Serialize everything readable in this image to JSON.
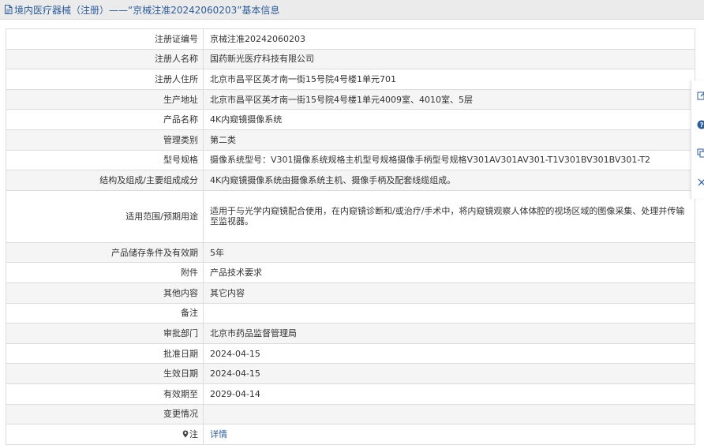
{
  "header": {
    "title": "境内医疗器械（注册）——“京械注准20242060203”基本信息"
  },
  "rows": [
    {
      "label": "注册证编号",
      "value": "京械注准20242060203"
    },
    {
      "label": "注册人名称",
      "value": "国药新光医疗科技有限公司"
    },
    {
      "label": "注册人住所",
      "value": "北京市昌平区英才南一街15号院4号楼1单元701"
    },
    {
      "label": "生产地址",
      "value": "北京市昌平区英才南一街15号院4号楼1单元4009室、4010室、5层"
    },
    {
      "label": "产品名称",
      "value": "4K内窥镜摄像系统"
    },
    {
      "label": "管理类别",
      "value": "第二类"
    },
    {
      "label": "型号规格",
      "value": "摄像系统型号：V301摄像系统规格主机型号规格摄像手柄型号规格V301AV301AV301-T1V301BV301BV301-T2"
    },
    {
      "label": "结构及组成/主要组成成分",
      "value": "4K内窥镜摄像系统由摄像系统主机、摄像手柄及配套线缆组成。"
    },
    {
      "label": "适用范围/预期用途",
      "value": "适用于与光学内窥镜配合使用，在内窥镜诊断和/或治疗/手术中，将内窥镜观察人体体腔的视场区域的图像采集、处理并传输至监视器。"
    },
    {
      "label": "产品储存条件及有效期",
      "value": "5年"
    },
    {
      "label": "附件",
      "value": "产品技术要求"
    },
    {
      "label": "其他内容",
      "value": "其它内容"
    },
    {
      "label": "备注",
      "value": ""
    },
    {
      "label": "审批部门",
      "value": "北京市药品监督管理局"
    },
    {
      "label": "批准日期",
      "value": "2024-04-15"
    },
    {
      "label": "生效日期",
      "value": "2024-04-15"
    },
    {
      "label": "有效期至",
      "value": "2029-04-14"
    },
    {
      "label": "变更情况",
      "value": ""
    },
    {
      "label": "注",
      "value": "详情"
    }
  ],
  "icons": {
    "header": "document-icon",
    "note": "map-pin-icon",
    "toolbar": [
      "edit-icon",
      "help-icon",
      "copy-icon",
      "close-icon"
    ]
  },
  "colors": {
    "link": "#2d5d9b",
    "header_bg": "#ebebeb",
    "border": "#dcdcdc",
    "toolbar_icon": "#2d5d9b"
  }
}
